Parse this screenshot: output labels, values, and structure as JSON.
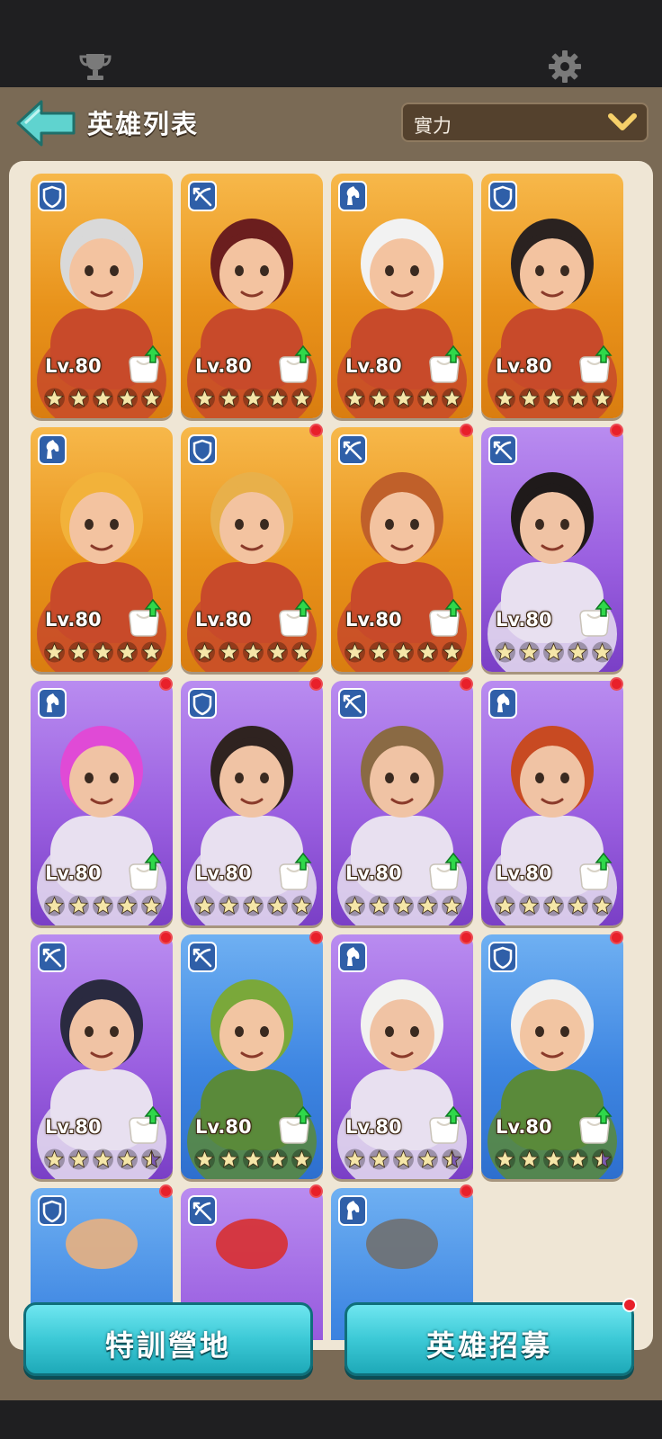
{
  "top_bar": {
    "icons": [
      "trophy-icon",
      "gear-icon"
    ]
  },
  "header": {
    "title": "英雄列表",
    "sort_value": "實力"
  },
  "heroes": [
    {
      "bg": "orange",
      "role": "shield",
      "level": "Lv.80",
      "stars": 5,
      "alert": false,
      "upgrade": true,
      "portrait": "silver-haired-swordsman"
    },
    {
      "bg": "orange",
      "role": "crossbow",
      "level": "Lv.80",
      "stars": 5,
      "alert": false,
      "upgrade": true,
      "portrait": "pirate-captain"
    },
    {
      "bg": "orange",
      "role": "horse",
      "level": "Lv.80",
      "stars": 5,
      "alert": false,
      "upgrade": true,
      "portrait": "hooded-nun"
    },
    {
      "bg": "orange",
      "role": "shield",
      "level": "Lv.80",
      "stars": 5,
      "alert": false,
      "upgrade": true,
      "portrait": "golden-warrior-woman"
    },
    {
      "bg": "orange",
      "role": "horse",
      "level": "Lv.80",
      "stars": 5,
      "alert": false,
      "upgrade": true,
      "portrait": "blonde-knight"
    },
    {
      "bg": "orange",
      "role": "shield",
      "level": "Lv.80",
      "stars": 5,
      "alert": true,
      "upgrade": true,
      "portrait": "braided-shieldmaiden"
    },
    {
      "bg": "orange",
      "role": "crossbow",
      "level": "Lv.80",
      "stars": 5,
      "alert": true,
      "upgrade": true,
      "portrait": "young-hunter"
    },
    {
      "bg": "purple",
      "role": "crossbow",
      "level": "Lv.80",
      "stars": 5,
      "alert": true,
      "upgrade": true,
      "portrait": "umbrella-shrine-maiden"
    },
    {
      "bg": "purple",
      "role": "horse",
      "level": "Lv.80",
      "stars": 5,
      "alert": true,
      "upgrade": true,
      "portrait": "pink-haired-gunner"
    },
    {
      "bg": "purple",
      "role": "shield",
      "level": "Lv.80",
      "stars": 5,
      "alert": true,
      "upgrade": true,
      "portrait": "bearded-brawler"
    },
    {
      "bg": "purple",
      "role": "crossbow",
      "level": "Lv.80",
      "stars": 5,
      "alert": true,
      "upgrade": true,
      "portrait": "scarf-archer"
    },
    {
      "bg": "purple",
      "role": "horse",
      "level": "Lv.80",
      "stars": 5,
      "alert": true,
      "upgrade": true,
      "portrait": "sombrero-bandit"
    },
    {
      "bg": "purple",
      "role": "crossbow",
      "level": "Lv.80",
      "stars": 4.5,
      "alert": true,
      "upgrade": true,
      "portrait": "wide-hat-swordswoman"
    },
    {
      "bg": "blue",
      "role": "crossbow",
      "level": "Lv.80",
      "stars": 5,
      "alert": true,
      "upgrade": true,
      "portrait": "green-hood-ranger"
    },
    {
      "bg": "purple",
      "role": "horse",
      "level": "Lv.80",
      "stars": 4.5,
      "alert": true,
      "upgrade": true,
      "portrait": "desert-sheikh"
    },
    {
      "bg": "blue",
      "role": "shield",
      "level": "Lv.80",
      "stars": 4.5,
      "alert": true,
      "upgrade": true,
      "portrait": "goggles-strongman"
    },
    {
      "bg": "blue",
      "role": "shield",
      "level": "",
      "stars": 0,
      "alert": true,
      "upgrade": false,
      "portrait": "partial"
    },
    {
      "bg": "purple",
      "role": "crossbow",
      "level": "",
      "stars": 0,
      "alert": true,
      "upgrade": false,
      "portrait": "partial"
    },
    {
      "bg": "blue",
      "role": "horse",
      "level": "",
      "stars": 0,
      "alert": true,
      "upgrade": false,
      "portrait": "partial"
    }
  ],
  "buttons": {
    "training_camp": "特訓營地",
    "hero_recruit": "英雄招募"
  },
  "colors": {
    "orange_card": "#e8921a",
    "purple_card": "#9a5fe0",
    "blue_card": "#3e86e2",
    "panel_bg": "#7a6a55",
    "grid_bg": "#efe6d5",
    "button": "#3cc9d6",
    "alert_dot": "#e8202a"
  }
}
